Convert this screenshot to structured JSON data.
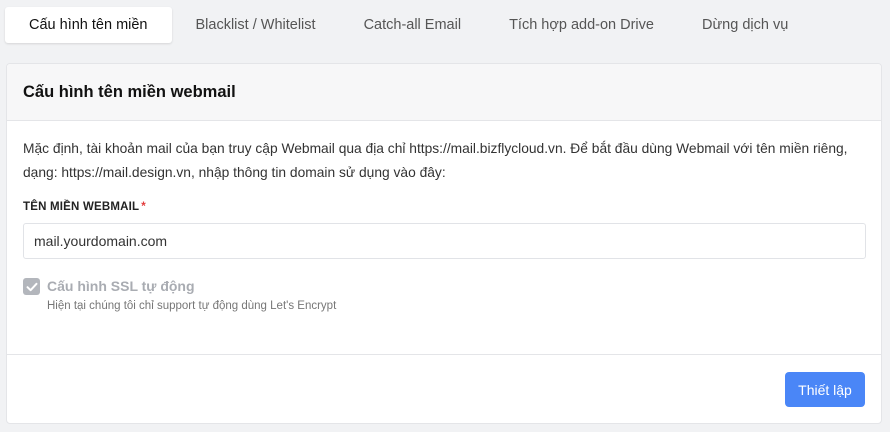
{
  "tabs": [
    {
      "label": "Cấu hình tên miền",
      "active": true
    },
    {
      "label": "Blacklist / Whitelist",
      "active": false
    },
    {
      "label": "Catch-all Email",
      "active": false
    },
    {
      "label": "Tích hợp add-on Drive",
      "active": false
    },
    {
      "label": "Dừng dịch vụ",
      "active": false
    }
  ],
  "card": {
    "title": "Cấu hình tên miền webmail",
    "description": "Mặc định, tài khoản mail của bạn truy cập Webmail qua địa chỉ https://mail.bizflycloud.vn. Để bắt đầu dùng Webmail với tên miền riêng, dạng: https://mail.design.vn, nhập thông tin domain sử dụng vào đây:",
    "field_label": "TÊN MIỀN WEBMAIL",
    "required_mark": "*",
    "input_value": "mail.yourdomain.com",
    "ssl_label": "Cấu hình SSL tự động",
    "ssl_checked": true,
    "ssl_help": "Hiện tại chúng tôi chỉ support tự động dùng Let's Encrypt",
    "submit_label": "Thiết lập"
  },
  "colors": {
    "primary": "#4a86f7",
    "required": "#e23d3d",
    "disabled_check": "#b3b6bc"
  }
}
